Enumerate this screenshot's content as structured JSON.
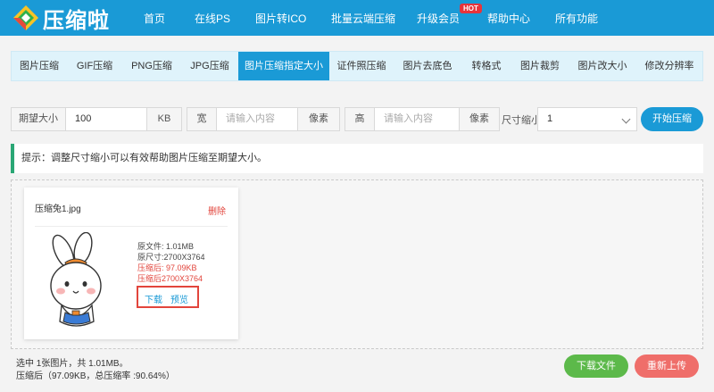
{
  "header": {
    "logo_text": "压缩啦",
    "nav": [
      {
        "label": "首页"
      },
      {
        "label": "在线PS"
      },
      {
        "label": "图片转ICO"
      },
      {
        "label": "批量云端压缩"
      },
      {
        "label": "升级会员"
      },
      {
        "label": "帮助中心"
      },
      {
        "label": "所有功能"
      }
    ],
    "hot_badge": "HOT",
    "colors": {
      "bar": "#1a9ad6"
    }
  },
  "tabs": [
    {
      "label": "图片压缩"
    },
    {
      "label": "GIF压缩"
    },
    {
      "label": "PNG压缩"
    },
    {
      "label": "JPG压缩"
    },
    {
      "label": "图片压缩指定大小"
    },
    {
      "label": "证件照压缩"
    },
    {
      "label": "图片去底色"
    },
    {
      "label": "转格式"
    },
    {
      "label": "图片裁剪"
    },
    {
      "label": "图片改大小"
    },
    {
      "label": "修改分辨率"
    }
  ],
  "options": {
    "expected_size_label": "期望大小",
    "expected_size_value": "100",
    "unit": "KB",
    "width_label": "宽",
    "width_placeholder": "请输入内容",
    "width_unit": "像素",
    "height_label": "高",
    "height_placeholder": "请输入内容",
    "height_unit": "像素",
    "scale_label": "尺寸缩小",
    "scale_value": "1",
    "start_button": "开始压缩"
  },
  "tip": "提示：调整尺寸缩小可以有效帮助图片压缩至期望大小。",
  "file_card": {
    "filename": "压缩兔1.jpg",
    "delete": "删除",
    "original_size": "原文件: 1.01MB",
    "original_dims": "原尺寸:2700X3764",
    "compressed_size": "压缩后: 97.09KB",
    "compressed_dims": "压缩后2700X3764",
    "download": "下载",
    "preview": "预览"
  },
  "summary": {
    "line1": "选中 1张图片，共 1.01MB。",
    "line2": "压缩后（97.09KB，总压缩率 :90.64%）"
  },
  "footer": {
    "download_button": "下载文件",
    "reupload_button": "重新上传"
  }
}
